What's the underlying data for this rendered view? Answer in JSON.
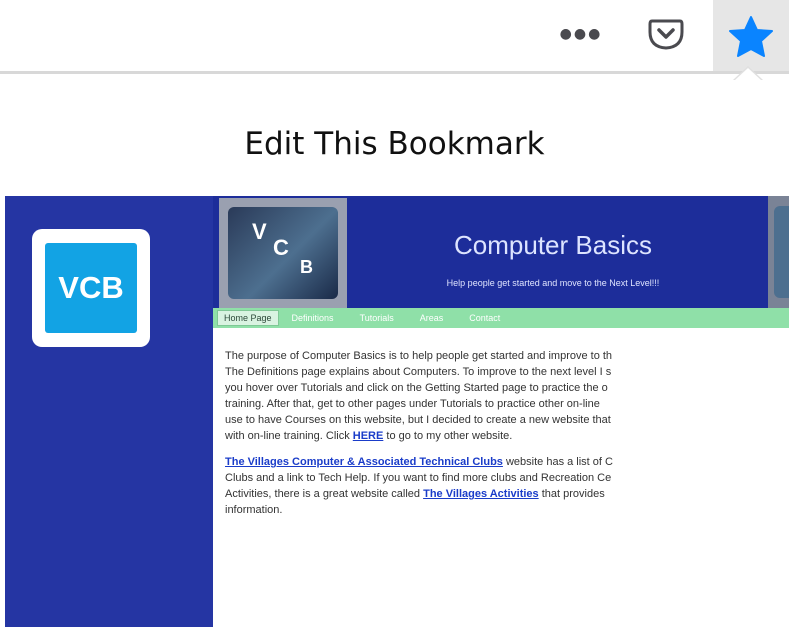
{
  "toolbar": {
    "more_glyph": "●●●",
    "more_icon": "more-dots-icon",
    "pocket_icon": "pocket-icon",
    "bookmark_icon": "star-filled-icon",
    "accent_color": "#0a84ff"
  },
  "panel": {
    "title": "Edit This Bookmark"
  },
  "preview": {
    "logo_text": "VCB",
    "header_logo": {
      "v": "V",
      "c": "C",
      "b": "B"
    },
    "site_title": "Computer Basics",
    "tagline": "Help people get started and move to the Next Level!!!",
    "nav": [
      "Home Page",
      "Definitions",
      "Tutorials",
      "Areas",
      "Contact"
    ],
    "paragraph1": {
      "text": "The purpose of Computer Basics is to help people get started and improve to th\nThe Definitions page explains about Computers.  To improve to the next level I s\nyou hover over Tutorials and click on the Getting Started page to practice the o\ntraining.  After that, get to other pages under Tutorials to practice other on-line\nuse to have Courses on this website, but I decided to create a new website that\nwith on-line training.  Click ",
      "link": "HERE",
      "after": " to go to my other website."
    },
    "paragraph2": {
      "link1": "The Villages Computer & Associated Technical Clubs",
      "text1": " website has a list of C\nClubs and a link to Tech Help.  If you want to find more clubs and Recreation Ce\nActivities, there is a great website called ",
      "link2": "The Villages Activities",
      "text2": " that provides\ninformation."
    },
    "colors": {
      "sidebar": "#2535a3",
      "header": "#1d2d9a",
      "nav": "#8fe0a8",
      "logo": "#12a3e4"
    }
  }
}
